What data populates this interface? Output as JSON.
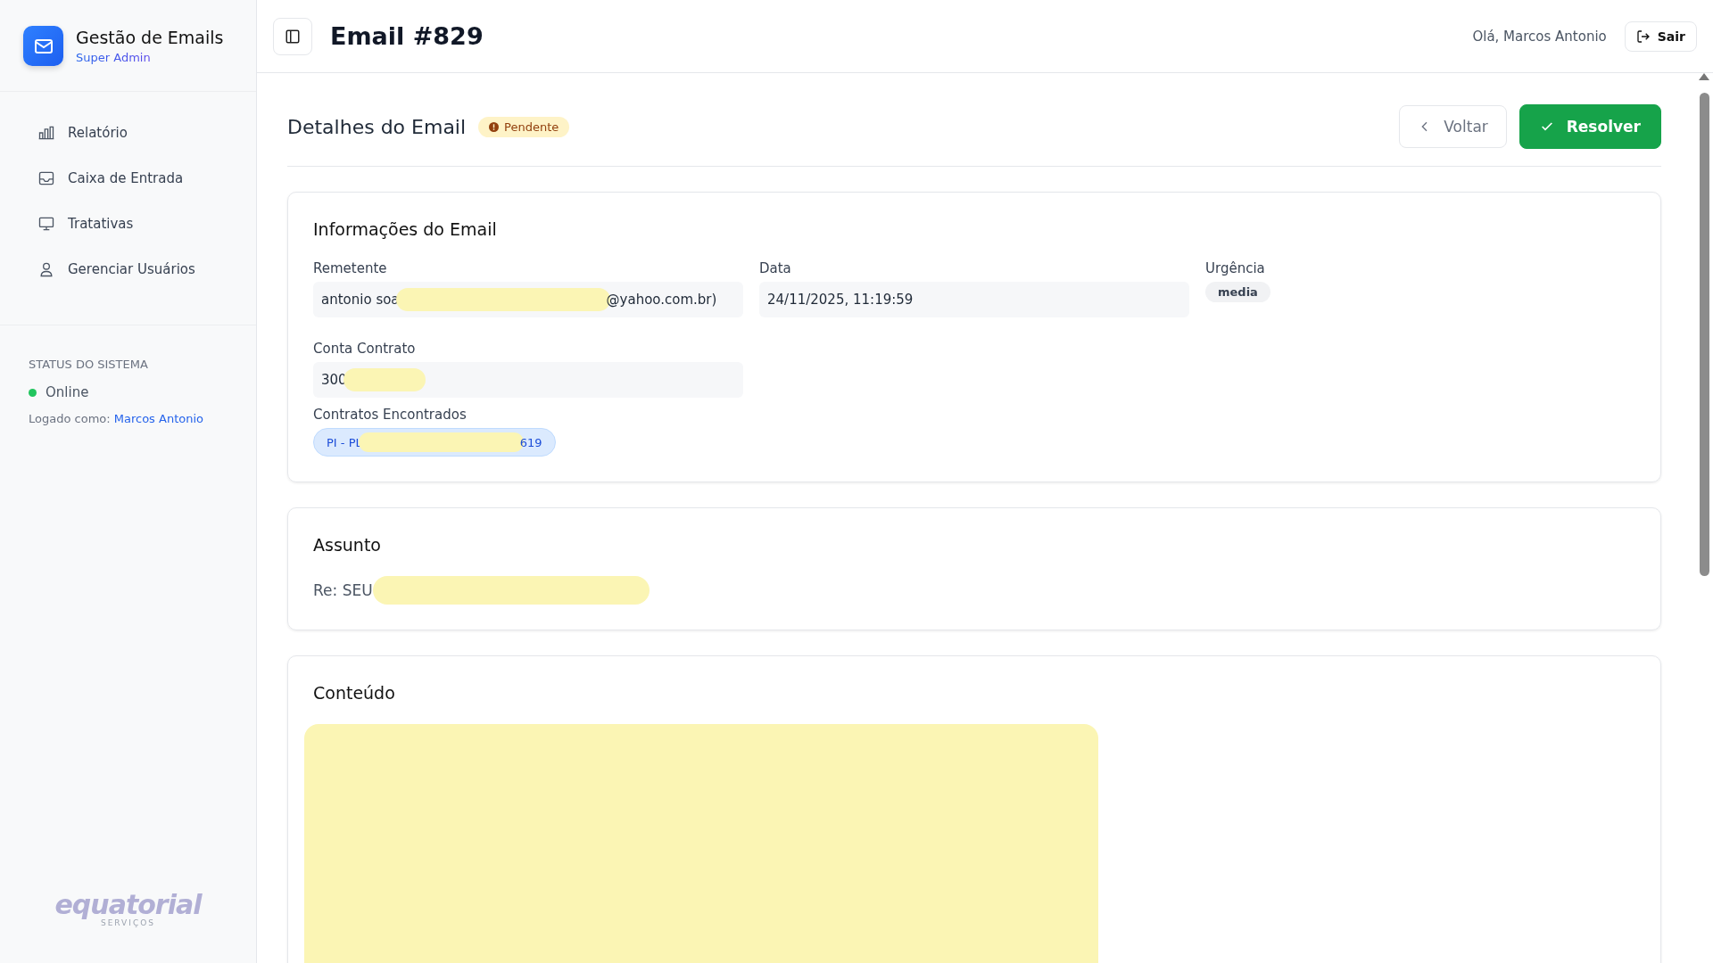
{
  "sidebar": {
    "app_title": "Gestão de Emails",
    "role": "Super Admin",
    "nav": [
      {
        "label": "Relatório",
        "selected": false
      },
      {
        "label": "Caixa de Entrada",
        "selected": false
      },
      {
        "label": "Tratativas",
        "selected": false
      },
      {
        "label": "Gerenciar Usuários",
        "selected": false
      }
    ],
    "status": {
      "heading": "STATUS DO SISTEMA",
      "state": "Online",
      "color": "#22c55e",
      "logged_label": "Logado como:",
      "user": "Marcos Antonio"
    },
    "logo": {
      "name": "equatorial",
      "tagline": "SERVIÇOS"
    }
  },
  "header": {
    "title": "Email #829",
    "greeting": "Olá, Marcos Antonio",
    "logout": "Sair"
  },
  "page": {
    "title": "Detalhes do Email",
    "status": "Pendente",
    "back": "Voltar",
    "resolve": "Resolver"
  },
  "info_card": {
    "title": "Informações do Email",
    "fields": [
      {
        "label": "Remetente",
        "parts": [
          "antonio soa",
          "@yahoo.com.br)"
        ]
      },
      {
        "label": "Data",
        "parts": [
          "24/11/2025, 11:19:59"
        ]
      },
      {
        "label": "Urgência",
        "badge": "media"
      },
      {
        "label": "Conta Contrato",
        "parts": [
          "300"
        ]
      }
    ],
    "contracts_label": "Contratos Encontrados",
    "contracts": [
      {
        "parts": [
          "PI - PL",
          "619"
        ]
      }
    ]
  },
  "subject_card": {
    "title": "Assunto",
    "parts": [
      "Re: SEU"
    ]
  },
  "content_card": {
    "title": "Conteúdo"
  }
}
